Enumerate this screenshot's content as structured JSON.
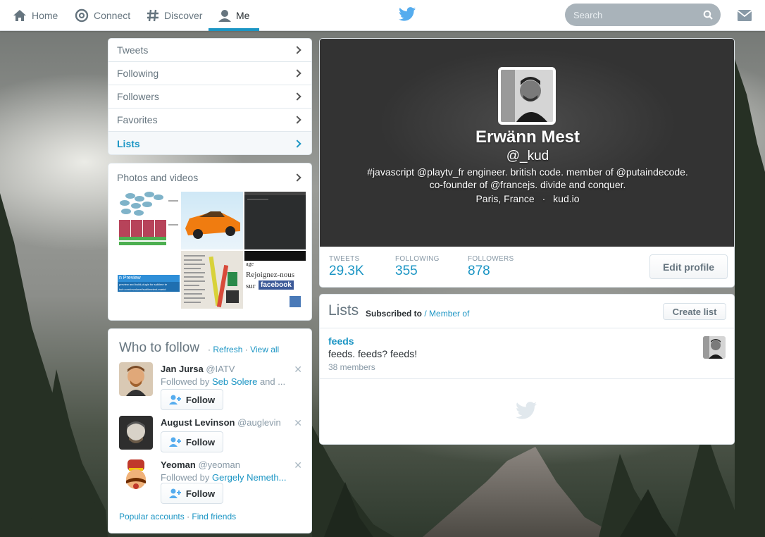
{
  "nav": {
    "home": "Home",
    "connect": "Connect",
    "discover": "Discover",
    "me": "Me"
  },
  "search": {
    "placeholder": "Search"
  },
  "colors": {
    "accent": "#1b95c4",
    "twitter_blue": "#55acee",
    "text_muted": "#66757f"
  },
  "sidebar": {
    "items": [
      {
        "label": "Tweets",
        "active": false
      },
      {
        "label": "Following",
        "active": false
      },
      {
        "label": "Followers",
        "active": false
      },
      {
        "label": "Favorites",
        "active": false
      },
      {
        "label": "Lists",
        "active": true
      }
    ]
  },
  "photos": {
    "title": "Photos and videos",
    "thumb_texts": {
      "t4": "n Preview",
      "t4_line1": "preview and build plugin for sublime te",
      "t4_line2": "kub.com/revolunet/sublimetext-markd",
      "t6_top": "age",
      "t6_main": "Rejoignez-nous",
      "t6_sur": "sur",
      "t6_fb": "facebook"
    }
  },
  "who_to_follow": {
    "title": "Who to follow",
    "separator": "·",
    "refresh": "Refresh",
    "view_all": "View all",
    "users": [
      {
        "name": "Jan Jursa",
        "handle": "@IATV",
        "followed_prefix": "Followed by",
        "followed_by": "Seb Solere",
        "followed_suffix": "and ..."
      },
      {
        "name": "August Levinson",
        "handle": "@auglevin"
      },
      {
        "name": "Yeoman",
        "handle": "@yeoman",
        "followed_prefix": "Followed by",
        "followed_by": "Gergely Nemeth..."
      }
    ],
    "follow_label": "Follow",
    "close_glyph": "✕",
    "footer": {
      "popular": "Popular accounts",
      "sep": "·",
      "find": "Find friends"
    }
  },
  "profile": {
    "name": "Erwänn Mest",
    "handle": "@_kud",
    "bio_line1": "#javascript @playtv_fr engineer. british code. member of @putaindecode.",
    "bio_line2": "co-founder of @francejs. divide and conquer.",
    "location": "Paris, France",
    "meta_sep": "·",
    "website": "kud.io",
    "stats": [
      {
        "label": "TWEETS",
        "value": "29.3K"
      },
      {
        "label": "FOLLOWING",
        "value": "355"
      },
      {
        "label": "FOLLOWERS",
        "value": "878"
      }
    ],
    "edit_label": "Edit profile"
  },
  "lists": {
    "title": "Lists",
    "subscribed": "Subscribed to",
    "slash": " / ",
    "member_of": "Member of",
    "create_label": "Create list",
    "items": [
      {
        "name": "feeds",
        "description": "feeds. feeds? feeds!",
        "count": "38 members"
      }
    ]
  }
}
